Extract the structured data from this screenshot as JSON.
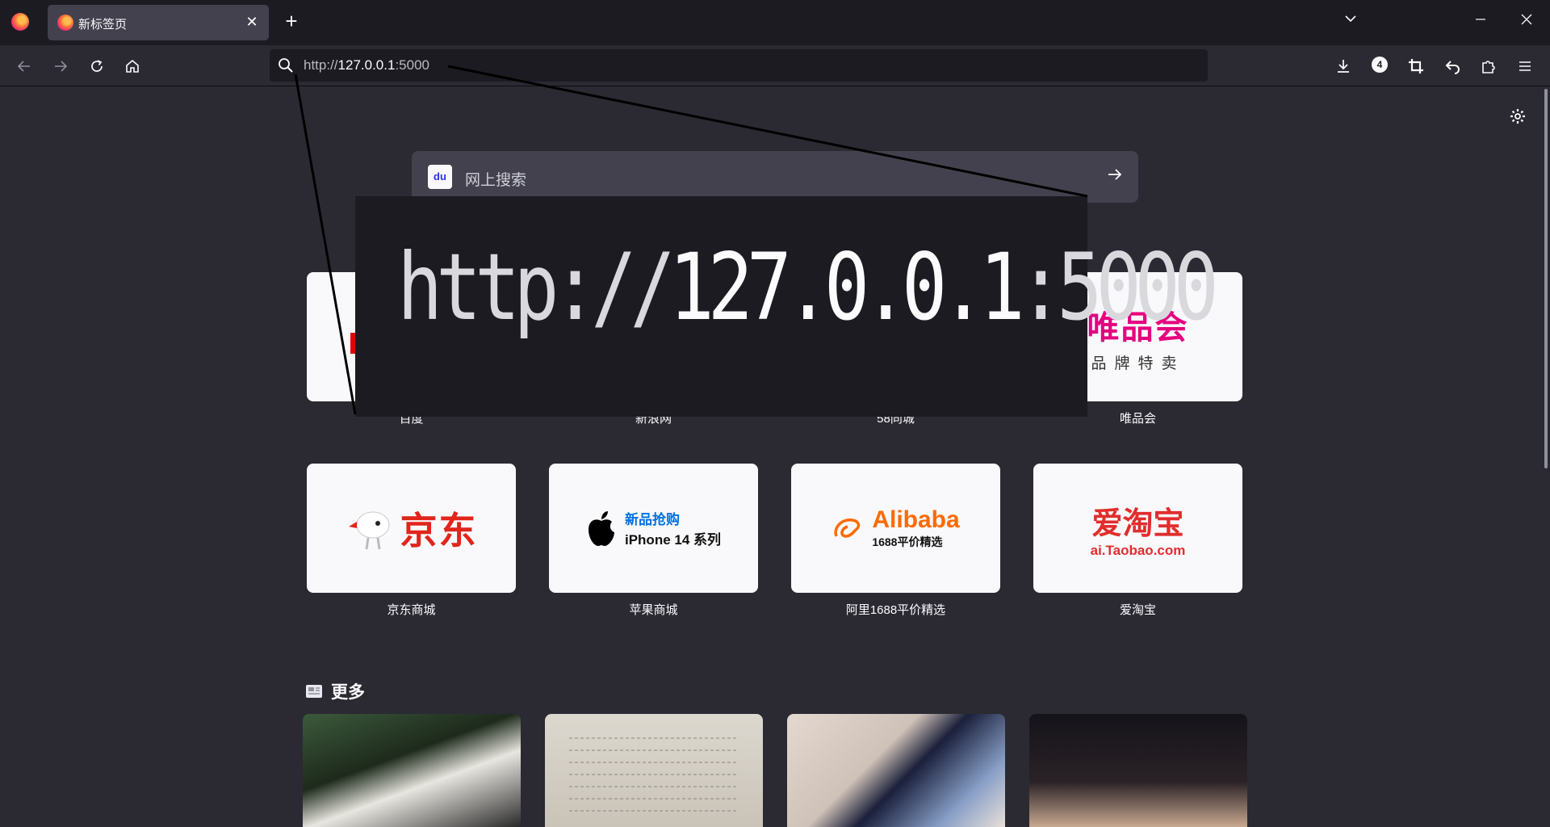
{
  "browser": {
    "tab": {
      "title": "新标签页",
      "close_label": "✕"
    },
    "new_tab_label": "+",
    "window_controls": {
      "list_all": "⌄",
      "minimize": "—",
      "restore": "❐",
      "close": "✕"
    },
    "urlbar": {
      "scheme": "http://",
      "host": "127.0.0.1",
      "port": ":5000"
    },
    "toolbar": {
      "extensions_badge": "4"
    }
  },
  "search": {
    "placeholder": "网上搜索",
    "engine_icon_text": "du"
  },
  "shortcuts": [
    {
      "label": "百度"
    },
    {
      "label": "新浪网"
    },
    {
      "label": "58同城"
    },
    {
      "label": "唯品会",
      "logo_main": "唯品会",
      "logo_sub": "品牌特卖"
    },
    {
      "label": "京东商城",
      "logo_main": "京东"
    },
    {
      "label": "苹果商城",
      "logo_line1": "新品抢购",
      "logo_line2": "iPhone 14 系列"
    },
    {
      "label": "阿里1688平价精选",
      "logo_main": "Alibaba",
      "logo_sub": "1688平价精选"
    },
    {
      "label": "爱淘宝",
      "logo_main": "爱淘宝",
      "logo_sub": "ai.Taobao.com"
    }
  ],
  "more_section": {
    "title": "更多"
  },
  "zoom": {
    "scheme": "http://",
    "host": "127.0.0.1",
    "port": ":5000"
  },
  "colors": {
    "page_bg": "#2b2a33",
    "titlebar_bg": "#1c1b22",
    "tile_bg": "#f9f9fb",
    "accent": "#0071e3"
  }
}
